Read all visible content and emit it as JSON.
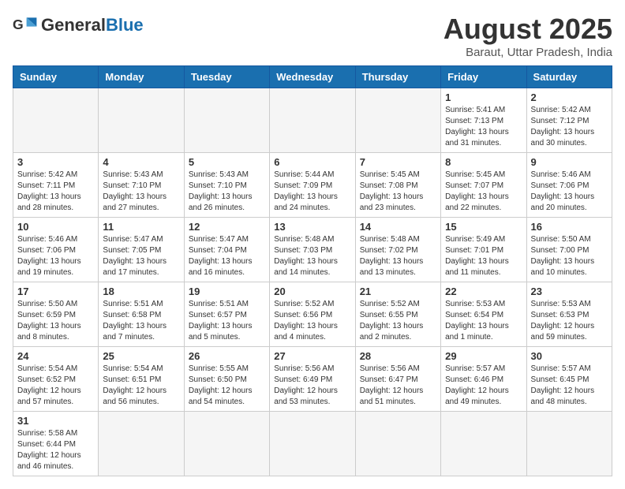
{
  "header": {
    "logo_general": "General",
    "logo_blue": "Blue",
    "title": "August 2025",
    "subtitle": "Baraut, Uttar Pradesh, India"
  },
  "weekdays": [
    "Sunday",
    "Monday",
    "Tuesday",
    "Wednesday",
    "Thursday",
    "Friday",
    "Saturday"
  ],
  "weeks": [
    [
      {
        "day": "",
        "info": "",
        "empty": true
      },
      {
        "day": "",
        "info": "",
        "empty": true
      },
      {
        "day": "",
        "info": "",
        "empty": true
      },
      {
        "day": "",
        "info": "",
        "empty": true
      },
      {
        "day": "",
        "info": "",
        "empty": true
      },
      {
        "day": "1",
        "info": "Sunrise: 5:41 AM\nSunset: 7:13 PM\nDaylight: 13 hours\nand 31 minutes."
      },
      {
        "day": "2",
        "info": "Sunrise: 5:42 AM\nSunset: 7:12 PM\nDaylight: 13 hours\nand 30 minutes."
      }
    ],
    [
      {
        "day": "3",
        "info": "Sunrise: 5:42 AM\nSunset: 7:11 PM\nDaylight: 13 hours\nand 28 minutes."
      },
      {
        "day": "4",
        "info": "Sunrise: 5:43 AM\nSunset: 7:10 PM\nDaylight: 13 hours\nand 27 minutes."
      },
      {
        "day": "5",
        "info": "Sunrise: 5:43 AM\nSunset: 7:10 PM\nDaylight: 13 hours\nand 26 minutes."
      },
      {
        "day": "6",
        "info": "Sunrise: 5:44 AM\nSunset: 7:09 PM\nDaylight: 13 hours\nand 24 minutes."
      },
      {
        "day": "7",
        "info": "Sunrise: 5:45 AM\nSunset: 7:08 PM\nDaylight: 13 hours\nand 23 minutes."
      },
      {
        "day": "8",
        "info": "Sunrise: 5:45 AM\nSunset: 7:07 PM\nDaylight: 13 hours\nand 22 minutes."
      },
      {
        "day": "9",
        "info": "Sunrise: 5:46 AM\nSunset: 7:06 PM\nDaylight: 13 hours\nand 20 minutes."
      }
    ],
    [
      {
        "day": "10",
        "info": "Sunrise: 5:46 AM\nSunset: 7:06 PM\nDaylight: 13 hours\nand 19 minutes."
      },
      {
        "day": "11",
        "info": "Sunrise: 5:47 AM\nSunset: 7:05 PM\nDaylight: 13 hours\nand 17 minutes."
      },
      {
        "day": "12",
        "info": "Sunrise: 5:47 AM\nSunset: 7:04 PM\nDaylight: 13 hours\nand 16 minutes."
      },
      {
        "day": "13",
        "info": "Sunrise: 5:48 AM\nSunset: 7:03 PM\nDaylight: 13 hours\nand 14 minutes."
      },
      {
        "day": "14",
        "info": "Sunrise: 5:48 AM\nSunset: 7:02 PM\nDaylight: 13 hours\nand 13 minutes."
      },
      {
        "day": "15",
        "info": "Sunrise: 5:49 AM\nSunset: 7:01 PM\nDaylight: 13 hours\nand 11 minutes."
      },
      {
        "day": "16",
        "info": "Sunrise: 5:50 AM\nSunset: 7:00 PM\nDaylight: 13 hours\nand 10 minutes."
      }
    ],
    [
      {
        "day": "17",
        "info": "Sunrise: 5:50 AM\nSunset: 6:59 PM\nDaylight: 13 hours\nand 8 minutes."
      },
      {
        "day": "18",
        "info": "Sunrise: 5:51 AM\nSunset: 6:58 PM\nDaylight: 13 hours\nand 7 minutes."
      },
      {
        "day": "19",
        "info": "Sunrise: 5:51 AM\nSunset: 6:57 PM\nDaylight: 13 hours\nand 5 minutes."
      },
      {
        "day": "20",
        "info": "Sunrise: 5:52 AM\nSunset: 6:56 PM\nDaylight: 13 hours\nand 4 minutes."
      },
      {
        "day": "21",
        "info": "Sunrise: 5:52 AM\nSunset: 6:55 PM\nDaylight: 13 hours\nand 2 minutes."
      },
      {
        "day": "22",
        "info": "Sunrise: 5:53 AM\nSunset: 6:54 PM\nDaylight: 13 hours\nand 1 minute."
      },
      {
        "day": "23",
        "info": "Sunrise: 5:53 AM\nSunset: 6:53 PM\nDaylight: 12 hours\nand 59 minutes."
      }
    ],
    [
      {
        "day": "24",
        "info": "Sunrise: 5:54 AM\nSunset: 6:52 PM\nDaylight: 12 hours\nand 57 minutes."
      },
      {
        "day": "25",
        "info": "Sunrise: 5:54 AM\nSunset: 6:51 PM\nDaylight: 12 hours\nand 56 minutes."
      },
      {
        "day": "26",
        "info": "Sunrise: 5:55 AM\nSunset: 6:50 PM\nDaylight: 12 hours\nand 54 minutes."
      },
      {
        "day": "27",
        "info": "Sunrise: 5:56 AM\nSunset: 6:49 PM\nDaylight: 12 hours\nand 53 minutes."
      },
      {
        "day": "28",
        "info": "Sunrise: 5:56 AM\nSunset: 6:47 PM\nDaylight: 12 hours\nand 51 minutes."
      },
      {
        "day": "29",
        "info": "Sunrise: 5:57 AM\nSunset: 6:46 PM\nDaylight: 12 hours\nand 49 minutes."
      },
      {
        "day": "30",
        "info": "Sunrise: 5:57 AM\nSunset: 6:45 PM\nDaylight: 12 hours\nand 48 minutes."
      }
    ],
    [
      {
        "day": "31",
        "info": "Sunrise: 5:58 AM\nSunset: 6:44 PM\nDaylight: 12 hours\nand 46 minutes."
      },
      {
        "day": "",
        "info": "",
        "empty": true
      },
      {
        "day": "",
        "info": "",
        "empty": true
      },
      {
        "day": "",
        "info": "",
        "empty": true
      },
      {
        "day": "",
        "info": "",
        "empty": true
      },
      {
        "day": "",
        "info": "",
        "empty": true
      },
      {
        "day": "",
        "info": "",
        "empty": true
      }
    ]
  ]
}
